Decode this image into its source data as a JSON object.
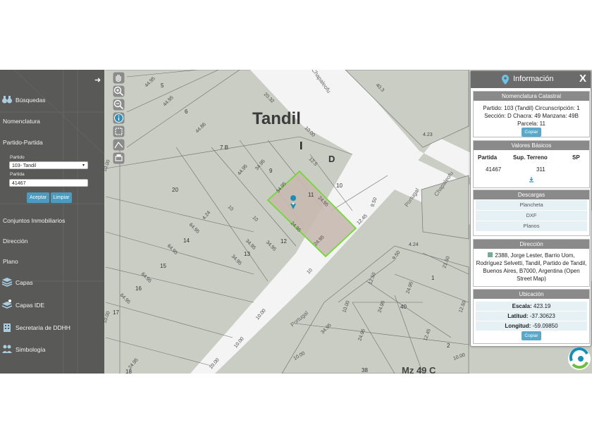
{
  "map": {
    "city_label": "Tandil",
    "zone_letter_i": "I",
    "zone_letter_d": "D",
    "manzana_label": "Mz 49 C",
    "streets": [
      "Chapaleofu",
      "Portugal",
      "Portugal",
      "Chapaleofu"
    ],
    "parcel_numbers": [
      "5",
      "6",
      "7 B",
      "9",
      "10",
      "11",
      "12",
      "13",
      "14",
      "15",
      "16",
      "17",
      "18",
      "20",
      "40",
      "1",
      "2",
      "38",
      "4.23",
      "40.3"
    ],
    "dimensions": [
      "44.95",
      "44.95",
      "44.86",
      "20.32",
      "10.00",
      "10.00",
      "12.5",
      "44.95",
      "34.95",
      "34.95",
      "24.95",
      "24.95",
      "24.95",
      "12.45",
      "9.50",
      "4.24",
      "10",
      "10",
      "10",
      "10",
      "64.95",
      "64.95",
      "64.95",
      "64.95",
      "34.95",
      "34.95",
      "34.95",
      "10.00",
      "10.00",
      "10.00",
      "10.00",
      "9.50",
      "21.50",
      "12.50",
      "24.95",
      "24.95",
      "10.00",
      "12.45",
      "10.00",
      "12.50",
      "24.95",
      "34.95",
      "10.00",
      "4.24",
      "24.95"
    ]
  },
  "sidebar": {
    "items": [
      {
        "label": "Búsquedas",
        "icon": "binoculars-icon"
      },
      {
        "label": "Nomenclatura"
      },
      {
        "label": "Partido-Partida"
      },
      {
        "label": "Conjuntos Inmobiliarios"
      },
      {
        "label": "Dirección"
      },
      {
        "label": "Plano"
      },
      {
        "label": "Capas",
        "icon": "layers-icon"
      },
      {
        "label": "Capas IDE",
        "icon": "layers-cloud-icon"
      },
      {
        "label": "Secretaría de DDHH",
        "icon": "building-icon"
      },
      {
        "label": "Simbología",
        "icon": "people-icon"
      }
    ],
    "partido_label": "Partido",
    "partido_value": "103- Tandil",
    "partida_label": "Partida",
    "partida_value": "41467",
    "accept_label": "Aceptar",
    "clear_label": "Limpiar"
  },
  "panel": {
    "title": "Información",
    "close": "X",
    "nomenclatura": {
      "heading": "Nomenclatura Catastral",
      "line1": "Partido: 103 (Tandil) Circunscripción: 1",
      "line2": "Sección: D Chacra: 49 Manzana: 49B",
      "line3": "Parcela: 11",
      "copy": "Copiar"
    },
    "valores": {
      "heading": "Valores Básicos",
      "col1": "Partida",
      "col2": "Sup. Terreno",
      "col3": "SP",
      "val1": "41467",
      "val2": "311"
    },
    "descargas": {
      "heading": "Descargas",
      "items": [
        "Plancheta",
        "DXF",
        "Planos"
      ]
    },
    "direccion": {
      "heading": "Dirección",
      "line1": "2388, Jorge Lester, Barrio Uom,",
      "line2": "Rodríguez Selvetti, Tandil, Partido de Tandil,",
      "line3": "Buenos Aires, B7000, Argentina (Open",
      "line4": "Street Map)"
    },
    "ubicacion": {
      "heading": "Ubicación",
      "escala_label": "Escala:",
      "escala": "423.19",
      "latitud_label": "Latitud:",
      "latitud": "-37.30623",
      "longitud_label": "Longitud:",
      "longitud": "-59.09850",
      "copy": "Copiar"
    }
  },
  "colors": {
    "parcel_fill": "#c9cdc4",
    "street": "#f4f4f4",
    "selected_outline": "#66dd22",
    "selected_fill": "#c8b9b0",
    "sidebar_bg": "#4b4b4b",
    "accent": "#4a9bbf"
  }
}
